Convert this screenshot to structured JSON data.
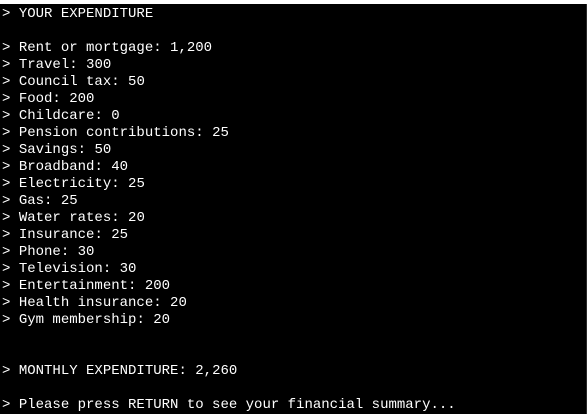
{
  "terminal": {
    "prompt": ">",
    "heading": "YOUR EXPENDITURE",
    "items": [
      {
        "label": "Rent or mortgage",
        "value": "1,200"
      },
      {
        "label": "Travel",
        "value": "300"
      },
      {
        "label": "Council tax",
        "value": "50"
      },
      {
        "label": "Food",
        "value": "200"
      },
      {
        "label": "Childcare",
        "value": "0"
      },
      {
        "label": "Pension contributions",
        "value": "25"
      },
      {
        "label": "Savings",
        "value": "50"
      },
      {
        "label": "Broadband",
        "value": "40"
      },
      {
        "label": "Electricity",
        "value": "25"
      },
      {
        "label": "Gas",
        "value": "25"
      },
      {
        "label": "Water rates",
        "value": "20"
      },
      {
        "label": "Insurance",
        "value": "25"
      },
      {
        "label": "Phone",
        "value": "30"
      },
      {
        "label": "Television",
        "value": "30"
      },
      {
        "label": "Entertainment",
        "value": "200"
      },
      {
        "label": "Health insurance",
        "value": "20"
      },
      {
        "label": "Gym membership",
        "value": "20"
      }
    ],
    "total_label": "MONTHLY EXPENDITURE",
    "total_value": "2,260",
    "footer_prompt": "Please press RETURN to see your financial summary..."
  }
}
